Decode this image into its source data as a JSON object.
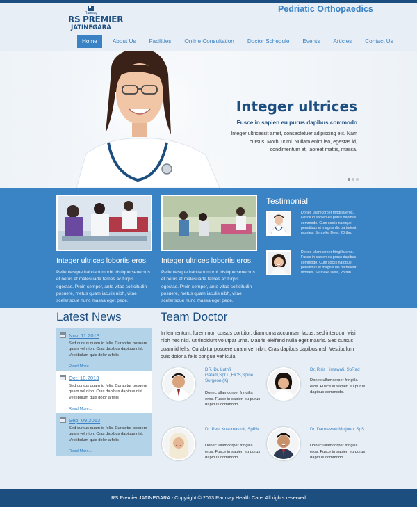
{
  "header": {
    "logo_small": "Ramsay",
    "logo_main": "RS PREMIER",
    "logo_sub": "JATINEGARA",
    "tagline": "Pedriatic Orthopaedics"
  },
  "nav": [
    {
      "label": "Home"
    },
    {
      "label": "About Us"
    },
    {
      "label": "Facilities"
    },
    {
      "label": "Online Consultation"
    },
    {
      "label": "Doctor Schedule"
    },
    {
      "label": "Events"
    },
    {
      "label": "Articles"
    },
    {
      "label": "Contact Us"
    }
  ],
  "hero": {
    "title": "Integer ultrices",
    "subtitle": "Fusce in sapien eu purus dapibus commodo",
    "body": "Integer ultricessit amet, consectetuer adipiscing elit. Nam cursus. Morbi ut mi. Nullam enim leo, egestas id, condimentum at, laoreet mattis, massa."
  },
  "features": [
    {
      "title": "Integer ultrices lobortis eros.",
      "body": "Pellentesque habitant morbi tristique senectus et netus et malesuada fames ac turpis egestas. Proin semper, ante vitae sollicitudin posuere, metus quam iaculis nibh, vitae scelerisque nunc massa eget pede."
    },
    {
      "title": "Integer ultrices lobortis eros.",
      "body": "Pellentesque habitant morbi tristique senectus et netus et malesuada fames ac turpis egestas. Proin semper, ante vitae sollicitudin posuere, metus quam iaculis nibh, vitae scelerisque nunc massa eget pede."
    }
  ],
  "testimonial": {
    "heading": "Testimonial",
    "items": [
      {
        "text": "Donec ullamcorper fringilla eros. Fusce in sapien eu purus dapibus commodo. Cum sociis natoque penatibus et magnis dis parturient montes. Seravika Dewi, 23 thn."
      },
      {
        "text": "Donec ullamcorper fringilla eros. Fusce in sapien eu purus dapibus commodo. Cum sociis natoque penatibus et magnis dis parturient montes. Seravika Dewi, 23 thn."
      }
    ]
  },
  "news": {
    "heading": "Latest News",
    "items": [
      {
        "date": "Nov. 11.2013",
        "text": "Sed cursus quam id felis. Curabitur posuere quam vel nibh. Cras dapibus dapibus nisl. Vestibulum quis dolor a felis",
        "more": "Read More..."
      },
      {
        "date": "Oct. 10.2013",
        "text": "Sed cursus quam id felis. Curabitur posuere quam vel nibh. Cras dapibus dapibus nisl. Vestibulum quis dolor a felis",
        "more": "Read More..."
      },
      {
        "date": "Sep. 09.2013",
        "text": "Sed cursus quam id felis. Curabitur posuere quam vel nibh. Cras dapibus dapibus nisl. Vestibulum quis dolor a felis",
        "more": "Read More..."
      }
    ]
  },
  "team": {
    "heading": "Team Doctor",
    "intro": "In fermentum, lorem non cursus porttitor, diam urna accumsan lacus, sed interdum wisi nibh nec nisl. Ut tincidunt volutpat urna. Mauris eleifend nulla eget mauris. Sed cursus quam id felis. Curabitur posuere quam vel nibh. Cras dapibus dapibus nisl. Vestibulum quis dolor a felis congue vehicula.",
    "doctors": [
      {
        "name": "DR. Dr. Luthfi Gatam,SpOT,FICS,Spine Surgeon (K)",
        "body": "Donec ullamcorper fringilla eros. Fusce in sapien eu purus dapibus commodo."
      },
      {
        "name": "Dr. Riris Himawati, SpRad",
        "body": "Donec ullamcorper fringilla eros. Fusce in sapien eu purus dapibus commodo."
      },
      {
        "name": "Dr. Peni Kusumastuti, SpRM",
        "body": "Donec ullamcorper fringilla eros. Fusce in sapien eu purus dapibus commodo."
      },
      {
        "name": "Dr. Darmawan Muljono, SpS",
        "body": "Donec ullamcorper fringilla eros. Fusce in sapien eu purus dapibus commodo."
      }
    ]
  },
  "footer": {
    "text": "RS Premier JATINEGARA - Copyright © 2013 Ramsay Health Care. All rights reserved"
  },
  "colors": {
    "navy": "#1d4e80",
    "accent_blue": "#3a83c4",
    "news_box": "#b3d3e9",
    "page_bg": "#e7eef5"
  },
  "icons": {
    "logo": "ramsay-logo-icon",
    "news_date": "calendar-icon",
    "slider": "slider-dot-icon"
  }
}
